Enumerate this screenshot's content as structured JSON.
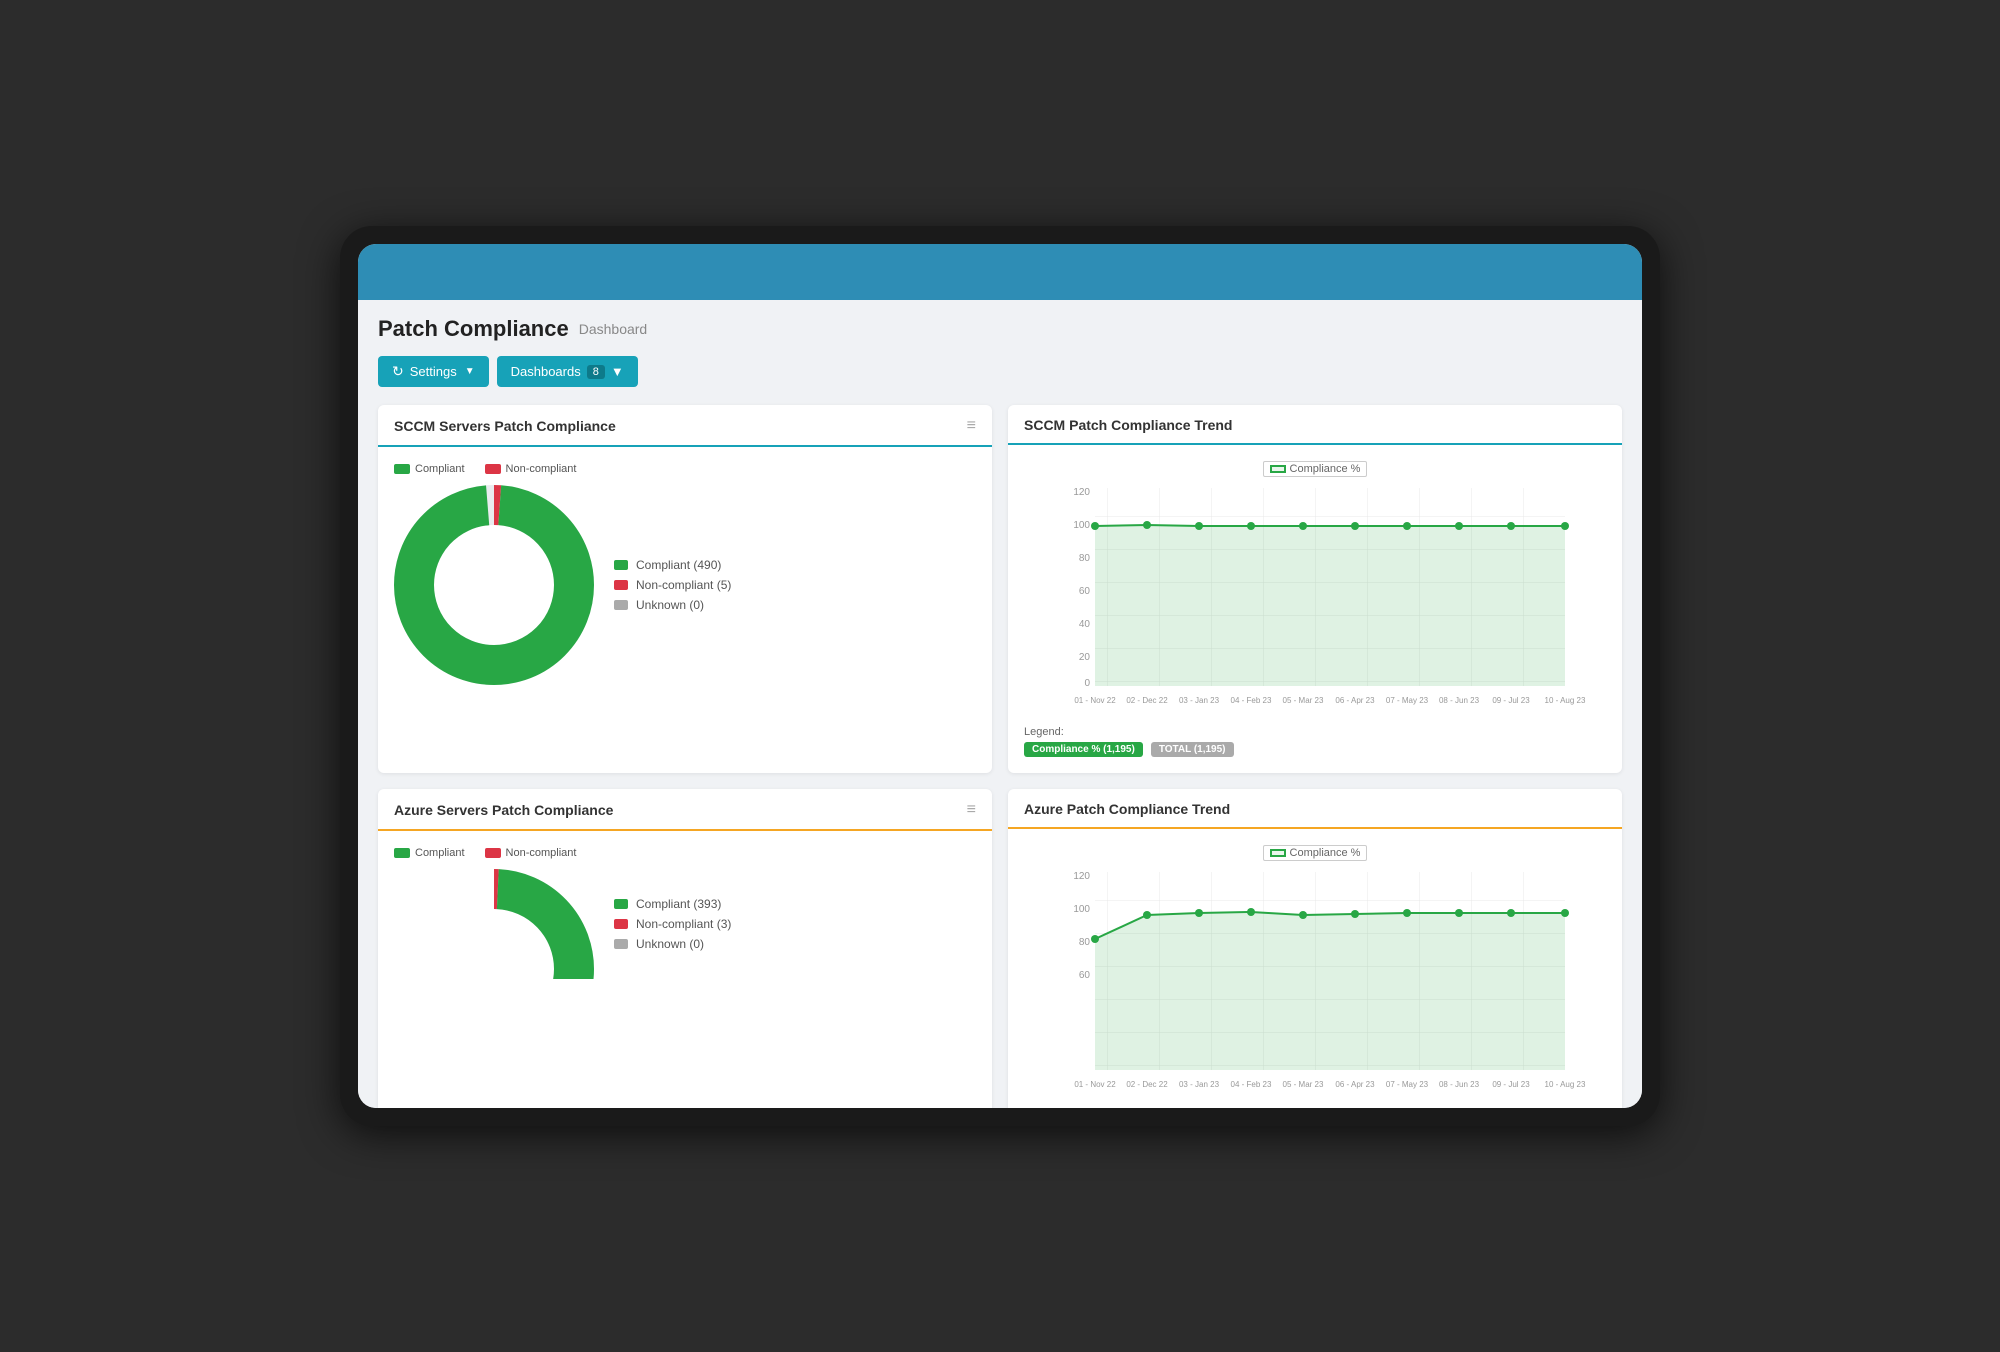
{
  "page": {
    "title": "Patch Compliance",
    "subtitle": "Dashboard"
  },
  "toolbar": {
    "settings_label": "Settings",
    "dashboards_label": "Dashboards",
    "dashboards_count": "8"
  },
  "sccm_donut": {
    "title": "SCCM Servers Patch Compliance",
    "compliant_label": "Compliant",
    "noncompliant_label": "Non-compliant",
    "legend": [
      {
        "label": "Compliant (490)",
        "color": "compliant"
      },
      {
        "label": "Non-compliant (5)",
        "color": "noncompliant"
      },
      {
        "label": "Unknown (0)",
        "color": "unknown"
      }
    ],
    "compliant_value": 490,
    "noncompliant_value": 5,
    "unknown_value": 0
  },
  "sccm_trend": {
    "title": "SCCM Patch Compliance Trend",
    "chart_label": "Compliance %",
    "y_labels": [
      "120",
      "100",
      "80",
      "60",
      "40",
      "20",
      "0"
    ],
    "x_labels": [
      "01 - Nov 22",
      "02 - Dec 22",
      "03 - Jan 23",
      "04 - Feb 23",
      "05 - Mar 23",
      "06 - Apr 23",
      "07 - May 23",
      "08 - Jun 23",
      "09 - Jul 23",
      "10 - Aug 23"
    ],
    "legend_text": "Legend:",
    "badge1": "Compliance % (1,195)",
    "badge2": "TOTAL (1,195)"
  },
  "azure_donut": {
    "title": "Azure Servers Patch Compliance",
    "compliant_label": "Compliant",
    "noncompliant_label": "Non-compliant",
    "legend": [
      {
        "label": "Compliant (393)",
        "color": "compliant"
      },
      {
        "label": "Non-compliant (3)",
        "color": "noncompliant"
      },
      {
        "label": "Unknown (0)",
        "color": "unknown"
      }
    ]
  },
  "azure_trend": {
    "title": "Azure Patch Compliance Trend",
    "chart_label": "Compliance %",
    "y_labels": [
      "120",
      "100",
      "80",
      "60"
    ],
    "x_labels": [
      "01 - Nov 22",
      "02 - Dec 22",
      "03 - Jan 23",
      "04 - Feb 23",
      "05 - Mar 23",
      "06 - Apr 23",
      "07 - May 23",
      "08 - Jun 23",
      "09 - Jul 23",
      "10 - Aug 23"
    ]
  }
}
